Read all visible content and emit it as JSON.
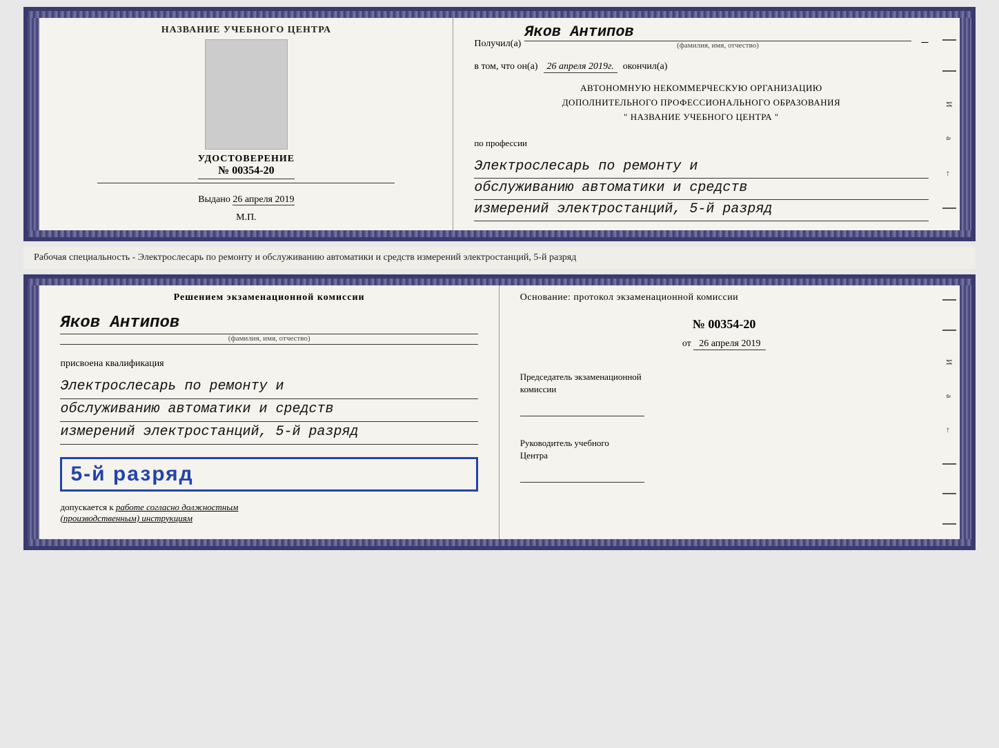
{
  "page": {
    "background": "#e8e8e8"
  },
  "top_cert": {
    "left": {
      "title": "НАЗВАНИЕ УЧЕБНОГО ЦЕНТРА",
      "photo_alt": "фото",
      "cert_label": "УДОСТОВЕРЕНИЕ",
      "cert_number": "№ 00354-20",
      "issued_label": "Выдано",
      "issued_date": "26 апреля 2019",
      "mp_label": "М.П."
    },
    "right": {
      "received_prefix": "Получил(а)",
      "received_name": "Яков Антипов",
      "name_subtitle": "(фамилия, имя, отчество)",
      "date_prefix": "в том, что он(а)",
      "date_value": "26 апреля 2019г.",
      "date_suffix": "окончил(а)",
      "org_line1": "АВТОНОМНУЮ НЕКОММЕРЧЕСКУЮ ОРГАНИЗАЦИЮ",
      "org_line2": "ДОПОЛНИТЕЛЬНОГО ПРОФЕССИОНАЛЬНОГО ОБРАЗОВАНИЯ",
      "org_line3": "\"   НАЗВАНИЕ УЧЕБНОГО ЦЕНТРА   \"",
      "profession_prefix": "по профессии",
      "profession_line1": "Электрослесарь по ремонту и",
      "profession_line2": "обслуживанию автоматики и средств",
      "profession_line3": "измерений электростанций, 5-й разряд",
      "spine_letters": [
        "И",
        "а",
        "←"
      ]
    }
  },
  "middle_strip": {
    "text": "Рабочая специальность - Электрослесарь по ремонту и обслуживанию автоматики и средств измерений электростанций, 5-й разряд"
  },
  "bottom_cert": {
    "left": {
      "decision_title": "Решением экзаменационной комиссии",
      "person_name": "Яков Антипов",
      "person_name_sub": "(фамилия, имя, отчество)",
      "qualification_prefix": "присвоена квалификация",
      "qual_line1": "Электрослесарь по ремонту и",
      "qual_line2": "обслуживанию автоматики и средств",
      "qual_line3": "измерений электростанций, 5-й разряд",
      "rank_text": "5-й разряд",
      "allowed_prefix": "допускается к",
      "allowed_value": "работе согласно должностным",
      "allowed_value2": "(производственным) инструкциям"
    },
    "right": {
      "basis_label": "Основание: протокол экзаменационной комиссии",
      "protocol_number": "№  00354-20",
      "date_prefix": "от",
      "date_value": "26 апреля 2019",
      "chairman_label": "Председатель экзаменационной",
      "chairman_label2": "комиссии",
      "director_label": "Руководитель учебного",
      "director_label2": "Центра",
      "spine_letters": [
        "И",
        "а",
        "←"
      ]
    }
  }
}
